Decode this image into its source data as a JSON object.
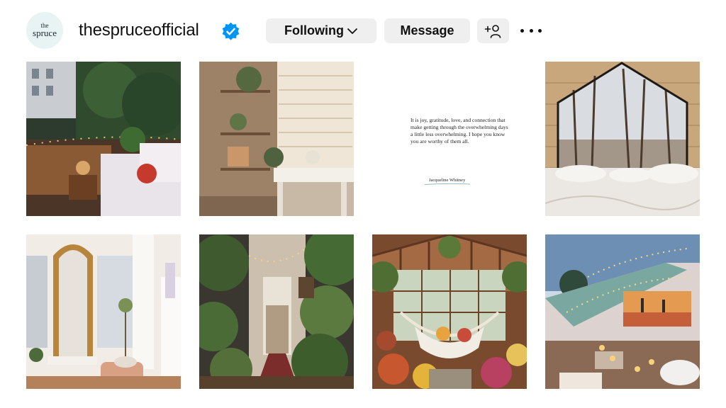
{
  "profile": {
    "avatar_line1": "the",
    "avatar_line2": "spruce",
    "username": "thespruceofficial",
    "verified": true
  },
  "actions": {
    "following_label": "Following",
    "message_label": "Message",
    "add_user_icon": "person-plus-icon",
    "more_icon": "more-dots-icon"
  },
  "colors": {
    "verified_blue": "#0095f6",
    "button_bg": "#efefef"
  },
  "posts": [
    {
      "subject": "Balcony with string lights"
    },
    {
      "subject": "Sunlit shelves and desk"
    },
    {
      "subject": "Quote card",
      "quote": "It is joy, gratitude, love, and connection that make getting through the overwhelming days a little less overwhelming. I hope you know you are worthy of them all.",
      "author": "Jacqueline Whitney"
    },
    {
      "subject": "A-frame bed with forest window"
    },
    {
      "subject": "Mirror and bright living room"
    },
    {
      "subject": "Plant-filled hallway"
    },
    {
      "subject": "Greenhouse with hammock"
    },
    {
      "subject": "Rooftop projector movie night"
    }
  ]
}
